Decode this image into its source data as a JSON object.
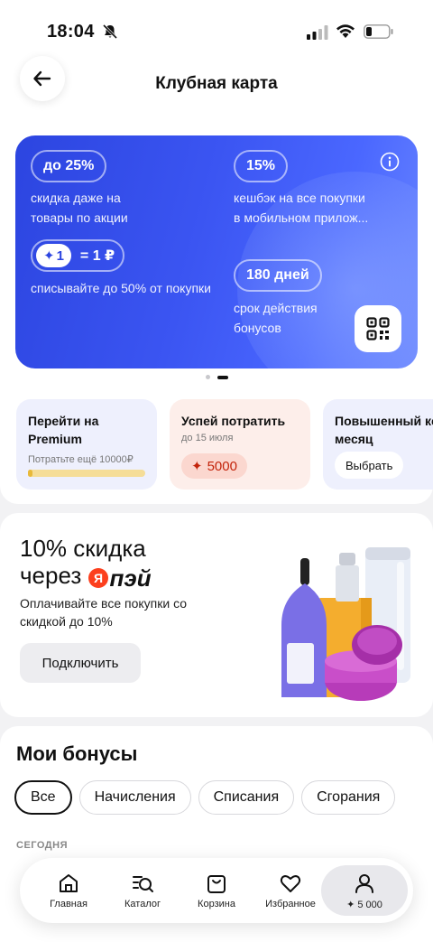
{
  "status_bar": {
    "time": "18:04"
  },
  "header": {
    "title": "Клубная карта"
  },
  "card": {
    "discount_pill": "до 25%",
    "discount_text": "скидка даже на товары по акции",
    "bonus_value": "1",
    "bonus_equals": "= 1 ₽",
    "bonus_text": "списывайте до 50% от покупки",
    "cashback_pill": "15%",
    "cashback_text": "кешбэк на все покупки в мобильном прилож...",
    "days_pill": "180 дней",
    "days_text": "срок действия бонусов"
  },
  "promos": [
    {
      "title": "Перейти на Premium",
      "subtitle": "Потратьте ещё 10000₽",
      "progress": 0.04
    },
    {
      "title": "Успей потратить",
      "subtitle": "до 15 июля",
      "badge": "5000"
    },
    {
      "title": "Повышенный ке на месяц",
      "button": "Выбрать"
    }
  ],
  "ypay": {
    "title_line1": "10% скидка",
    "title_line2": "через",
    "logo_text": "пэй",
    "logo_letter": "Я",
    "subtitle": "Оплачивайте все покупки со скидкой до 10%",
    "button": "Подключить"
  },
  "bonuses": {
    "title": "Мои бонусы",
    "filters": [
      "Все",
      "Начисления",
      "Списания",
      "Сгорания"
    ],
    "section_label": "СЕГОДНЯ"
  },
  "tabbar": {
    "items": [
      {
        "label": "Главная",
        "icon": "home-icon"
      },
      {
        "label": "Каталог",
        "icon": "catalog-search-icon"
      },
      {
        "label": "Корзина",
        "icon": "bag-icon"
      },
      {
        "label": "Избранное",
        "icon": "heart-icon"
      },
      {
        "label": "✦ 5 000",
        "icon": "profile-icon"
      }
    ]
  },
  "colors": {
    "card_blue": "#3b55f2",
    "accent_red": "#c3240b",
    "progress_yellow": "#e8b93a"
  }
}
